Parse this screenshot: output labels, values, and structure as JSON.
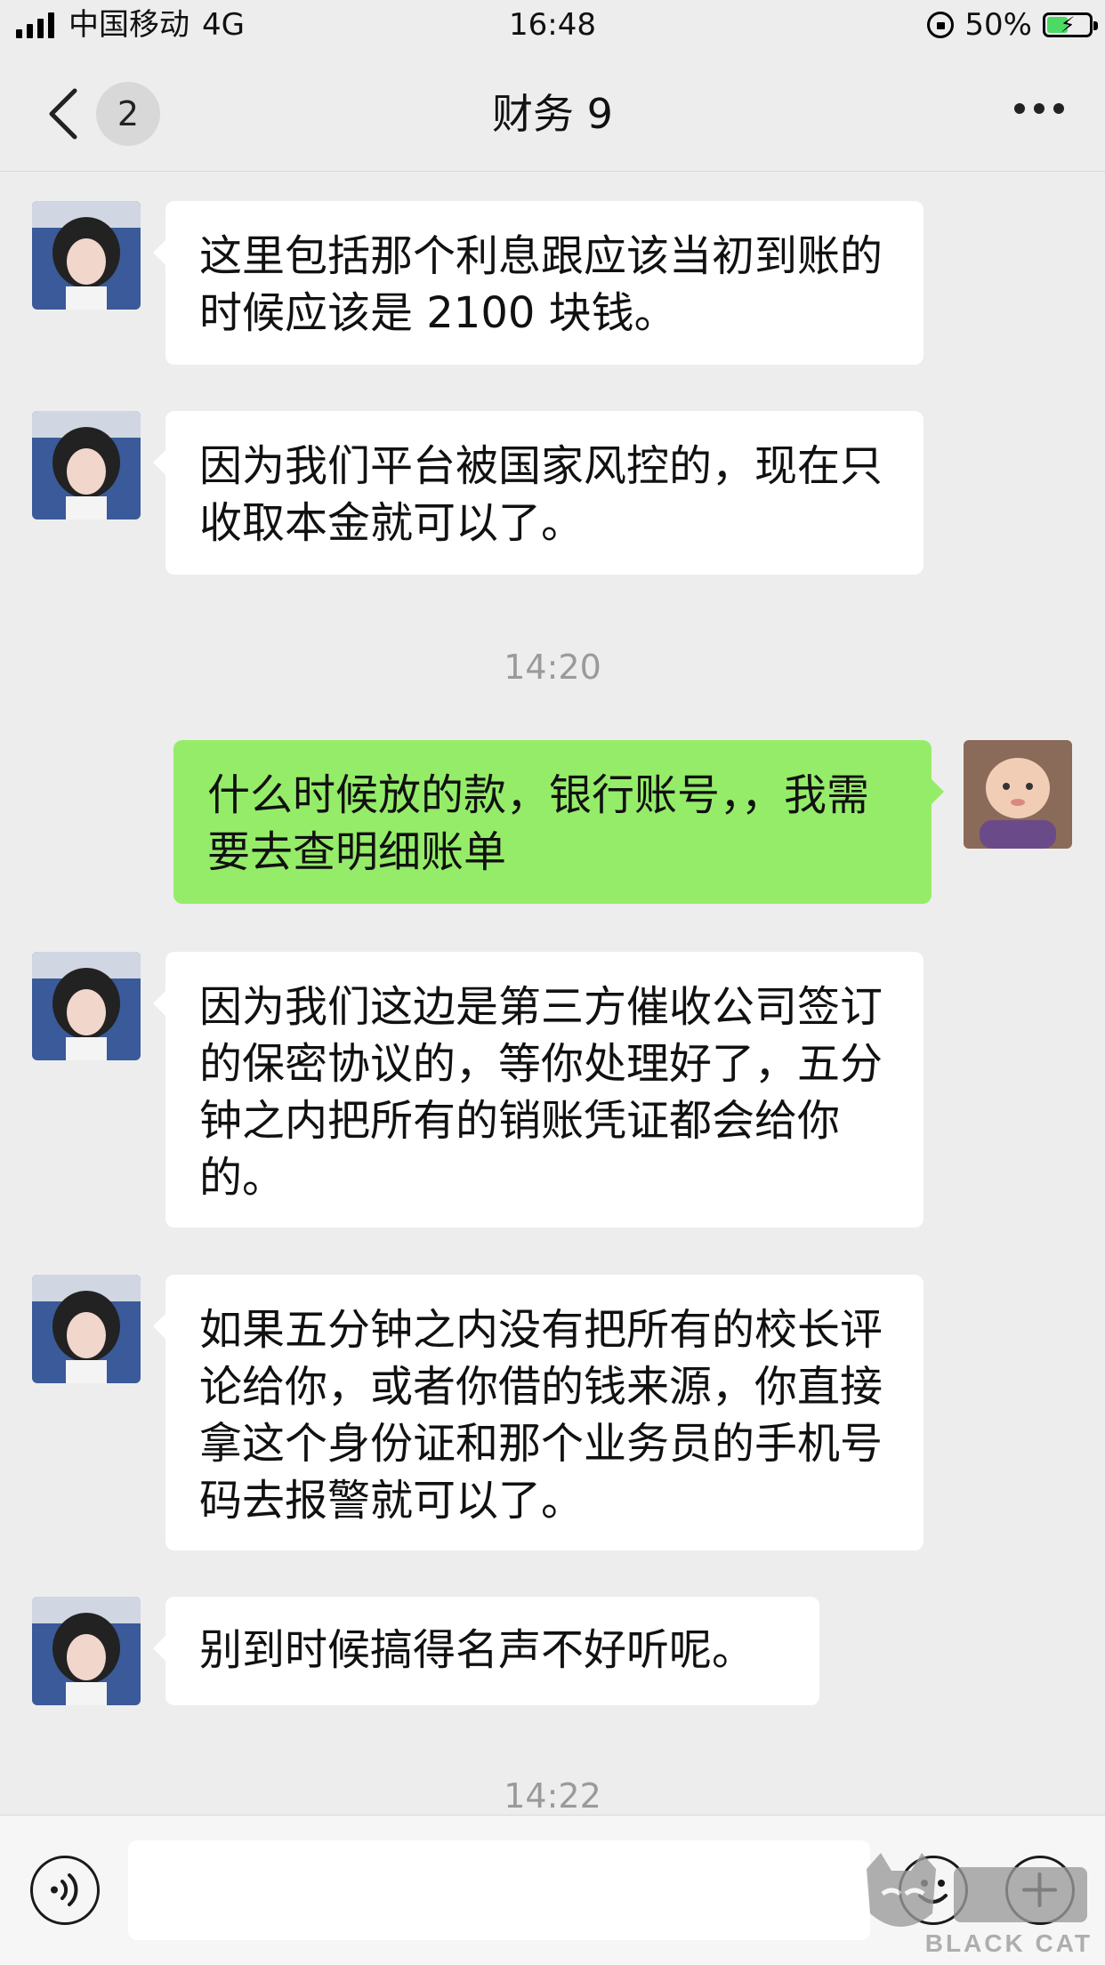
{
  "status_bar": {
    "carrier": "中国移动",
    "network": "4G",
    "time": "16:48",
    "battery_pct": "50%",
    "battery_level": 0.5
  },
  "nav": {
    "unread_badge": "2",
    "title": "财务 9",
    "back_icon": "chevron-left-icon",
    "more_icon": "more-dots-icon"
  },
  "messages": [
    {
      "side": "in",
      "text": "这里包括那个利息跟应该当初到账的时候应该是 2100 块钱。"
    },
    {
      "side": "in",
      "text": "因为我们平台被国家风控的，现在只收取本金就可以了。"
    },
    {
      "side": "time",
      "text": "14:20"
    },
    {
      "side": "out",
      "text": "什么时候放的款，银行账号，，我需要去查明细账单"
    },
    {
      "side": "in",
      "text": "因为我们这边是第三方催收公司签订的保密协议的，等你处理好了，五分钟之内把所有的销账凭证都会给你的。"
    },
    {
      "side": "in",
      "text": "如果五分钟之内没有把所有的校长评论给你，或者你借的钱来源，你直接拿这个身份证和那个业务员的手机号码去报警就可以了。"
    },
    {
      "side": "in",
      "text": "别到时候搞得名声不好听呢。"
    },
    {
      "side": "time",
      "text": "14:22"
    }
  ],
  "input_bar": {
    "voice_icon": "voice-icon",
    "emoji_icon": "emoji-icon",
    "plus_icon": "plus-icon"
  },
  "watermark": {
    "text": "BLACK CAT"
  },
  "colors": {
    "background": "#ededed",
    "incoming_bubble": "#ffffff",
    "outgoing_bubble": "#95ec69",
    "timestamp": "#9a9a9a"
  }
}
